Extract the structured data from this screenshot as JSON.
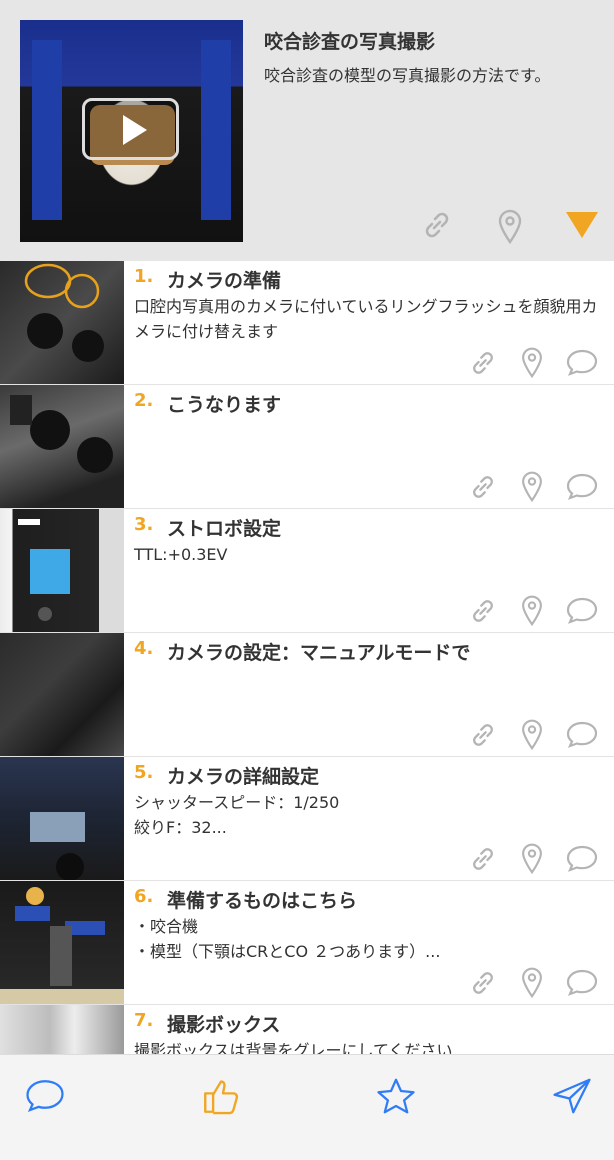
{
  "header": {
    "title": "咬合診査の写真撮影",
    "description": "咬合診査の模型の写真撮影の方法です。",
    "icons": [
      "link-icon",
      "location-pin-icon",
      "collapse-triangle-icon"
    ],
    "accent_color": "#f0a623"
  },
  "steps": [
    {
      "number": "1.",
      "title": "カメラの準備",
      "description": "口腔内写真用のカメラに付いているリングフラッシュを顔貌用カメラに付け替えます"
    },
    {
      "number": "2.",
      "title": "こうなります",
      "description": ""
    },
    {
      "number": "3.",
      "title": "ストロボ設定",
      "description": "TTL:+0.3EV"
    },
    {
      "number": "4.",
      "title": "カメラの設定：マニュアルモードで",
      "description": ""
    },
    {
      "number": "5.",
      "title": "カメラの詳細設定",
      "description": "シャッタースピード：1/250\n絞りF：32..."
    },
    {
      "number": "6.",
      "title": "準備するものはこちら",
      "description": "・咬合機\n・模型（下顎はCRとCO ２つあります）..."
    },
    {
      "number": "7.",
      "title": "撮影ボックス",
      "description": "撮影ボックスは背景をグレーにしてください"
    }
  ],
  "toolbar": {
    "items": [
      "comment-icon",
      "thumbs-up-icon",
      "star-icon",
      "send-icon"
    ],
    "icon_color": "#2f7cf6",
    "like_color": "#f0a623"
  }
}
